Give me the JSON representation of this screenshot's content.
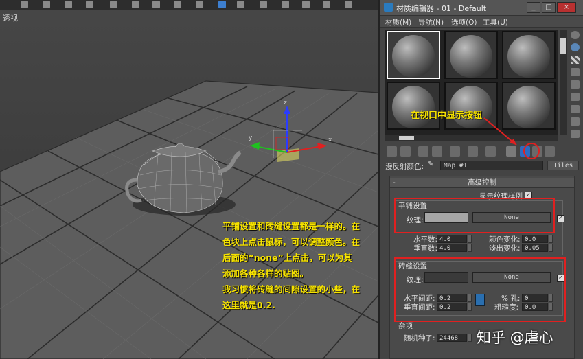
{
  "viewport": {
    "label": "透视"
  },
  "material_editor": {
    "title": "材质编辑器 - 01 - Default",
    "window_buttons": [
      "_",
      "□",
      "×"
    ],
    "menu": [
      "材质(M)",
      "导航(N)",
      "选项(O)",
      "工具(U)"
    ],
    "slot_count": 6,
    "map_row": {
      "label": "漫反射颜色:",
      "map_name": "Map #1",
      "map_type": "Tiles"
    },
    "rollout": {
      "title": "高级控制",
      "minus": "-",
      "show_texture_label": "显示纹理样例",
      "tiles_setup": {
        "group_title": "平铺设置",
        "texture_label": "纹理:",
        "texture_color": "#a6a6a6",
        "map_button": "None",
        "horizontal_count_label": "水平数:",
        "horizontal_count": "4.0",
        "vertical_count_label": "垂直数:",
        "vertical_count": "4.0",
        "color_variance_label": "颜色变化:",
        "color_variance": "0.0",
        "fade_variance_label": "淡出变化:",
        "fade_variance": "0.05"
      },
      "grout_setup": {
        "group_title": "砖缝设置",
        "texture_label": "纹理:",
        "texture_color": "#3a3a3a",
        "map_button": "None",
        "horizontal_gap_label": "水平间距:",
        "horizontal_gap": "0.2",
        "vertical_gap_label": "垂直间距:",
        "vertical_gap": "0.2",
        "holes_label": "% 孔:",
        "holes": "0",
        "roughness_label": "粗糙度:",
        "roughness": "0.0"
      },
      "misc": {
        "group_title": "杂项",
        "seed_label": "随机种子:",
        "seed": "24468"
      }
    }
  },
  "annotations": {
    "top": "在视口中显示按钮",
    "main": [
      "平铺设置和砖缝设置都是一样的。在",
      "色块上点击鼠标，可以调整颜色。在",
      "后面的“none”上点击，可以为其",
      "添加各种各样的贴图。",
      "我习惯将砖缝的间隙设置的小些，在",
      "这里就是0.2."
    ],
    "color": "#f6e200"
  },
  "watermark": "知乎 @虐心"
}
